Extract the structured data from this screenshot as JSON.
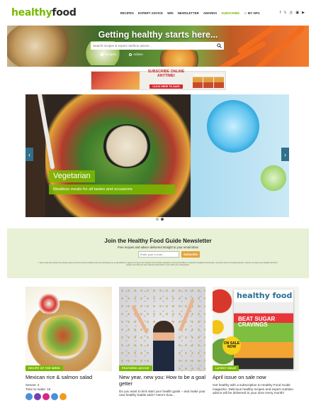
{
  "brand": {
    "logo_main": "healthy",
    "logo_accent": "food",
    "accent_color": "#7ab800"
  },
  "nav": {
    "items": [
      "RECIPES",
      "EXPERT ADVICE",
      "WIN",
      "NEWSLETTER",
      "AWARDS"
    ],
    "subscribe": "SUBSCRIBE",
    "account": "MY HFG",
    "social_icons": [
      "facebook-icon",
      "twitter-icon",
      "pinterest-icon",
      "instagram-icon",
      "youtube-icon"
    ]
  },
  "hero": {
    "title": "Getting healthy starts here...",
    "search_placeholder": "Search recipes & expert nutrition advice...",
    "options": [
      "Recipes",
      "Advice"
    ]
  },
  "ad": {
    "line1": "SUBSCRIBE ONLINE",
    "line2": "ANYTIME!",
    "cta": "CLICK HERE TO SAVE"
  },
  "slider": {
    "title": "Vegetarian",
    "subtitle": "Meatless meals for all tastes and occasions",
    "prev": "‹",
    "next": "›",
    "dots": 2,
    "active_dot": 1
  },
  "newsletter": {
    "title": "Join the Healthy Food Guide Newsletter",
    "subtitle": "Free recipes and advice delivered straight to your email inbox",
    "email_placeholder": "Enter your e-mail...",
    "button": "Subscribe",
    "fine_print": "I have read and accept the privacy policy and terms and conditions and by submitting my email address I agree to receive the Healthy Food Guide newsletter and special offers on behalf of Healthy Food Guide, members and our trusted partners. We do not share your details with third parties and will only send relevant information in line with your subscription."
  },
  "cards": [
    {
      "tag": "RECIPE OF THE WEEK",
      "title": "Mexican rice & salmon salad",
      "meta": [
        "Serves: 2",
        "Time to make: 15"
      ],
      "badge_colors": [
        "#4a90d9",
        "#7a3fb3",
        "#d8268a",
        "#4a90d9",
        "#f29a1f"
      ]
    },
    {
      "tag": "FEATURED ADVICE",
      "title": "New year, new you: How to be a goal getter",
      "text": "Do you want to kick start your health goals – and make your new healthy habits stick? Here's how..."
    },
    {
      "tag": "LATEST ISSUE",
      "title": "April issue on sale now",
      "text": "Get healthy with a subscription to Healthy Food Guide magazine. Delicious healthy recipes and expert nutrition advice will be delivered to your door every month!",
      "cover_title": "healthy food",
      "cover_headline": "BEAT SUGAR CRAVINGS",
      "sale_badge": "ON SALE NOW"
    }
  ]
}
